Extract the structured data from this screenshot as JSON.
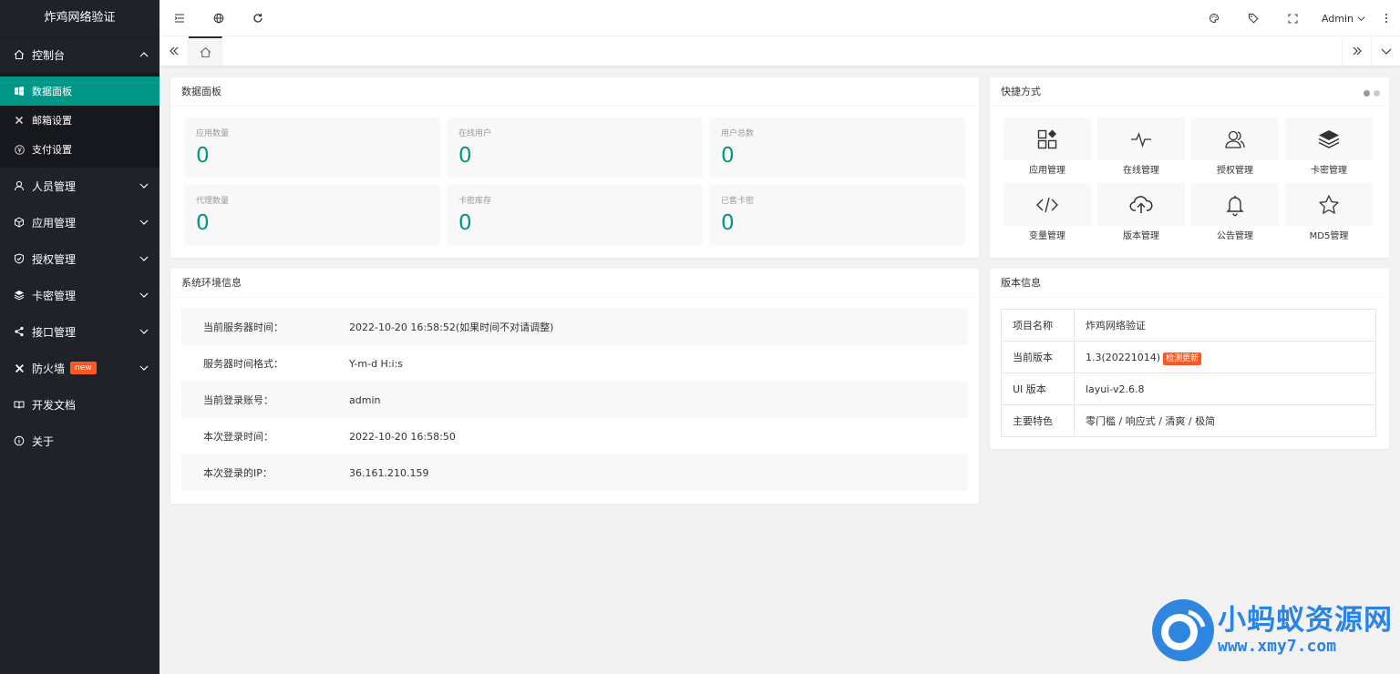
{
  "app": {
    "title": "炸鸡网络验证"
  },
  "sidebar": {
    "items": [
      {
        "label": "控制台",
        "icon": "home-icon"
      },
      {
        "label": "人员管理",
        "icon": "user-icon"
      },
      {
        "label": "应用管理",
        "icon": "cube-icon"
      },
      {
        "label": "授权管理",
        "icon": "shield-icon"
      },
      {
        "label": "卡密管理",
        "icon": "layers-icon"
      },
      {
        "label": "接口管理",
        "icon": "share-icon"
      },
      {
        "label": "防火墙",
        "icon": "tool-icon",
        "badge": "new"
      },
      {
        "label": "开发文档",
        "icon": "book-icon"
      },
      {
        "label": "关于",
        "icon": "info-icon"
      }
    ],
    "console_sub": [
      {
        "label": "数据面板",
        "icon": "windows-icon"
      },
      {
        "label": "邮箱设置",
        "icon": "tool-icon"
      },
      {
        "label": "支付设置",
        "icon": "yen-icon"
      }
    ]
  },
  "header": {
    "user": "Admin"
  },
  "data_panel": {
    "title": "数据面板",
    "stats": [
      {
        "label": "应用数量",
        "value": "0"
      },
      {
        "label": "在线用户",
        "value": "0"
      },
      {
        "label": "用户总数",
        "value": "0"
      },
      {
        "label": "代理数量",
        "value": "0"
      },
      {
        "label": "卡密库存",
        "value": "0"
      },
      {
        "label": "已售卡密",
        "value": "0"
      }
    ]
  },
  "shortcuts": {
    "title": "快捷方式",
    "items": [
      {
        "label": "应用管理",
        "icon": "apps-icon"
      },
      {
        "label": "在线管理",
        "icon": "pulse-icon"
      },
      {
        "label": "授权管理",
        "icon": "users-icon"
      },
      {
        "label": "卡密管理",
        "icon": "layers-icon"
      },
      {
        "label": "变量管理",
        "icon": "code-icon"
      },
      {
        "label": "版本管理",
        "icon": "cloud-upload-icon"
      },
      {
        "label": "公告管理",
        "icon": "bell-icon"
      },
      {
        "label": "MD5管理",
        "icon": "star-icon"
      }
    ]
  },
  "env": {
    "title": "系统环境信息",
    "rows": [
      {
        "k": "当前服务器时间：",
        "v": "2022-10-20 16:58:52(如果时间不对请调整)"
      },
      {
        "k": "服务器时间格式：",
        "v": "Y-m-d H:i:s"
      },
      {
        "k": "当前登录账号：",
        "v": "admin"
      },
      {
        "k": "本次登录时间：",
        "v": "2022-10-20 16:58:50"
      },
      {
        "k": "本次登录的IP：",
        "v": "36.161.210.159"
      }
    ]
  },
  "version": {
    "title": "版本信息",
    "rows": [
      {
        "k": "项目名称",
        "v": "炸鸡网络验证"
      },
      {
        "k": "当前版本",
        "v": "1.3(20221014)",
        "badge": "检测更新"
      },
      {
        "k": "UI 版本",
        "v": "layui-v2.6.8"
      },
      {
        "k": "主要特色",
        "v": "零门槛 / 响应式 / 清爽 / 极简"
      }
    ]
  },
  "watermark": {
    "cn": "小蚂蚁资源网",
    "url": "www.xmy7.com"
  },
  "colors": {
    "accent": "#009688",
    "sidebar": "#20222a",
    "badge": "#ff5722"
  }
}
